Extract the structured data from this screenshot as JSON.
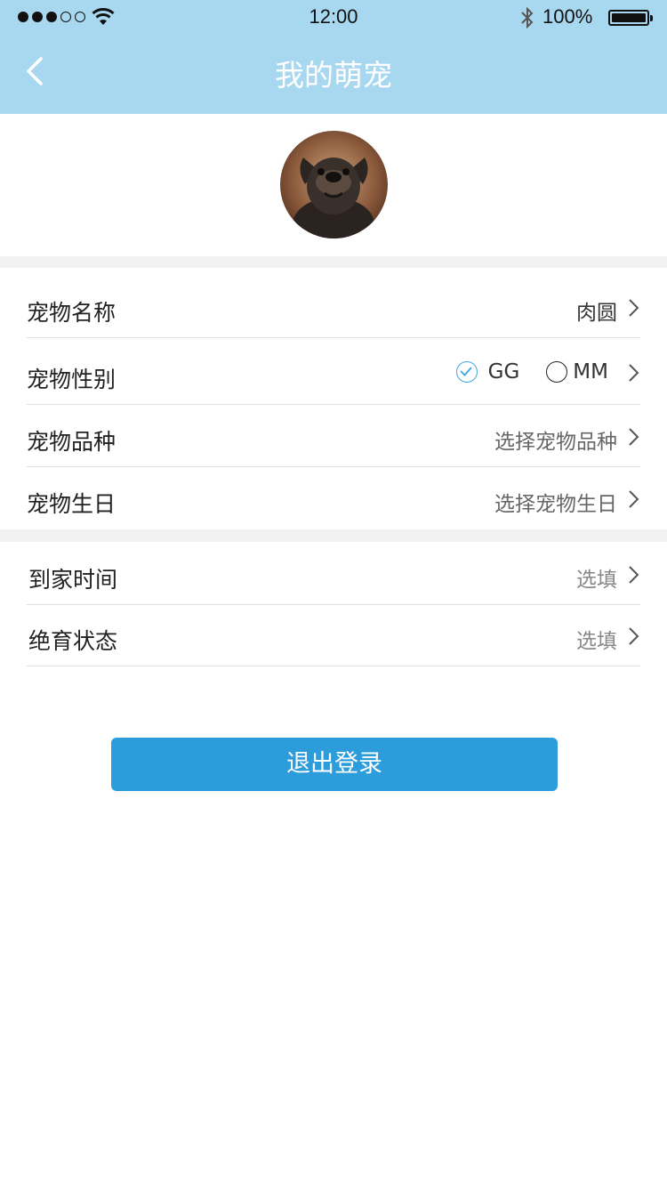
{
  "status_bar": {
    "time": "12:00",
    "battery": "100%"
  },
  "nav": {
    "title": "我的萌宠"
  },
  "pet_info": [
    {
      "label": "宠物名称",
      "value": "肉圆"
    },
    {
      "label": "宠物性别",
      "options": [
        "GG",
        "MM"
      ],
      "selected": "GG"
    },
    {
      "label": "宠物品种",
      "value": "选择宠物品种"
    },
    {
      "label": "宠物生日",
      "value": "选择宠物生日"
    }
  ],
  "optional_info": [
    {
      "label": "到家时间",
      "value": "选填"
    },
    {
      "label": "绝育状态",
      "value": "选填"
    }
  ],
  "logout_label": "退出登录",
  "colors": {
    "header": "#a8d8f0",
    "button": "#2c9cdb",
    "check": "#3fa7e1"
  }
}
